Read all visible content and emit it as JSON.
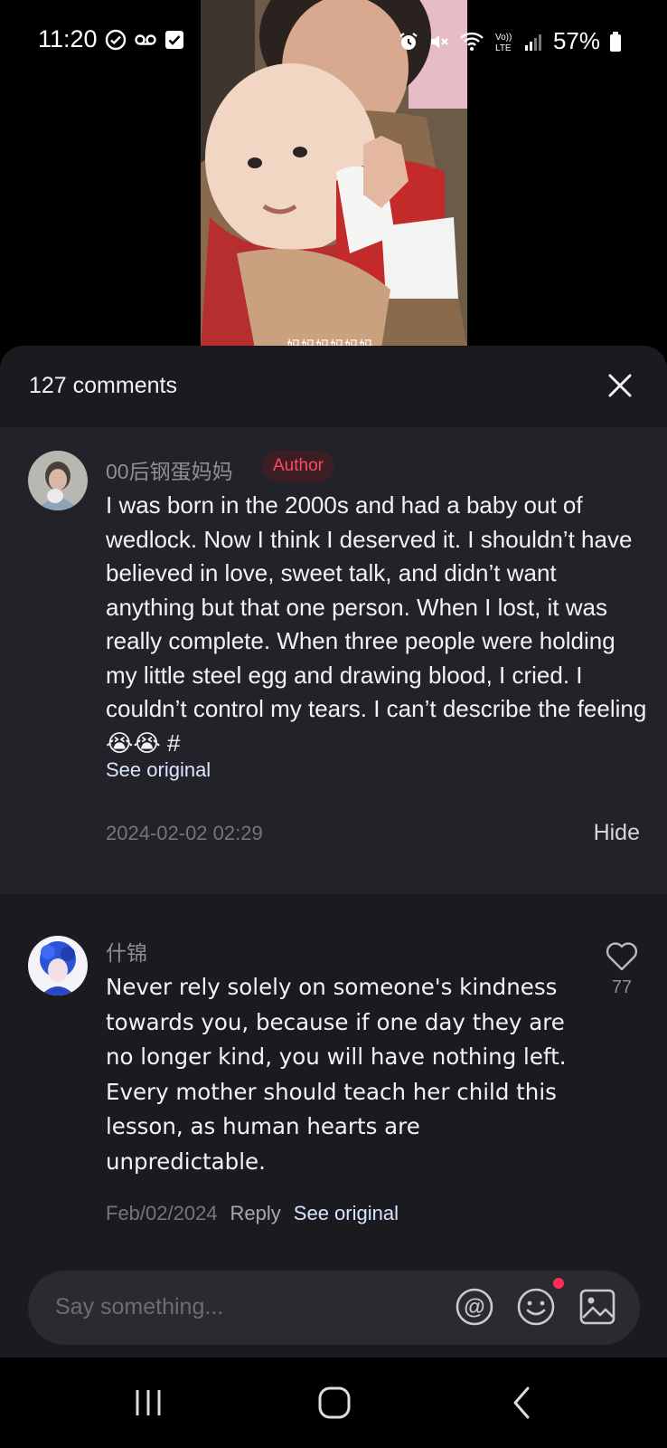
{
  "status_bar": {
    "time": "11:20",
    "battery": "57%",
    "left_icons": [
      "check-circle-icon",
      "voicemail-icon",
      "checkbox-icon"
    ],
    "right_icons": [
      "alarm-icon",
      "mute-icon",
      "wifi-icon",
      "volte-icon",
      "signal-icon",
      "battery-icon"
    ]
  },
  "video": {
    "caption": "妈妈妈妈妈妈"
  },
  "sheet": {
    "count_label": "127 comments"
  },
  "comments": [
    {
      "user": "00后钢蛋妈妈",
      "badge": "Author",
      "text": "I was born in the 2000s and had a baby out of wedlock. Now I think I deserved it. I shouldn’t have believed in love, sweet talk, and didn’t want anything but that one person. When I lost, it was really complete. When three people were holding my little steel egg and drawing blood, I cried. I couldn’t control my tears. I can’t describe the feeling😭😭 #",
      "see_original": "See original",
      "date": "2024-02-02 02:29",
      "hide": "Hide"
    },
    {
      "user": "什锦",
      "text": "Never rely solely on someone's kindness towards you, because if one day they are no longer kind, you will have nothing left. Every mother should teach her child this lesson, as human hearts are unpredictable.",
      "likes": "77",
      "date": "Feb/02/2024",
      "reply": "Reply",
      "see_original": "See original"
    }
  ],
  "composer": {
    "placeholder": "Say something..."
  },
  "colors": {
    "sheet_bg": "#1a1a1f",
    "author_bg": "#222228",
    "badge_text": "#ff4a5c",
    "link": "#d9e6ff",
    "notification_dot": "#ff2d55"
  }
}
